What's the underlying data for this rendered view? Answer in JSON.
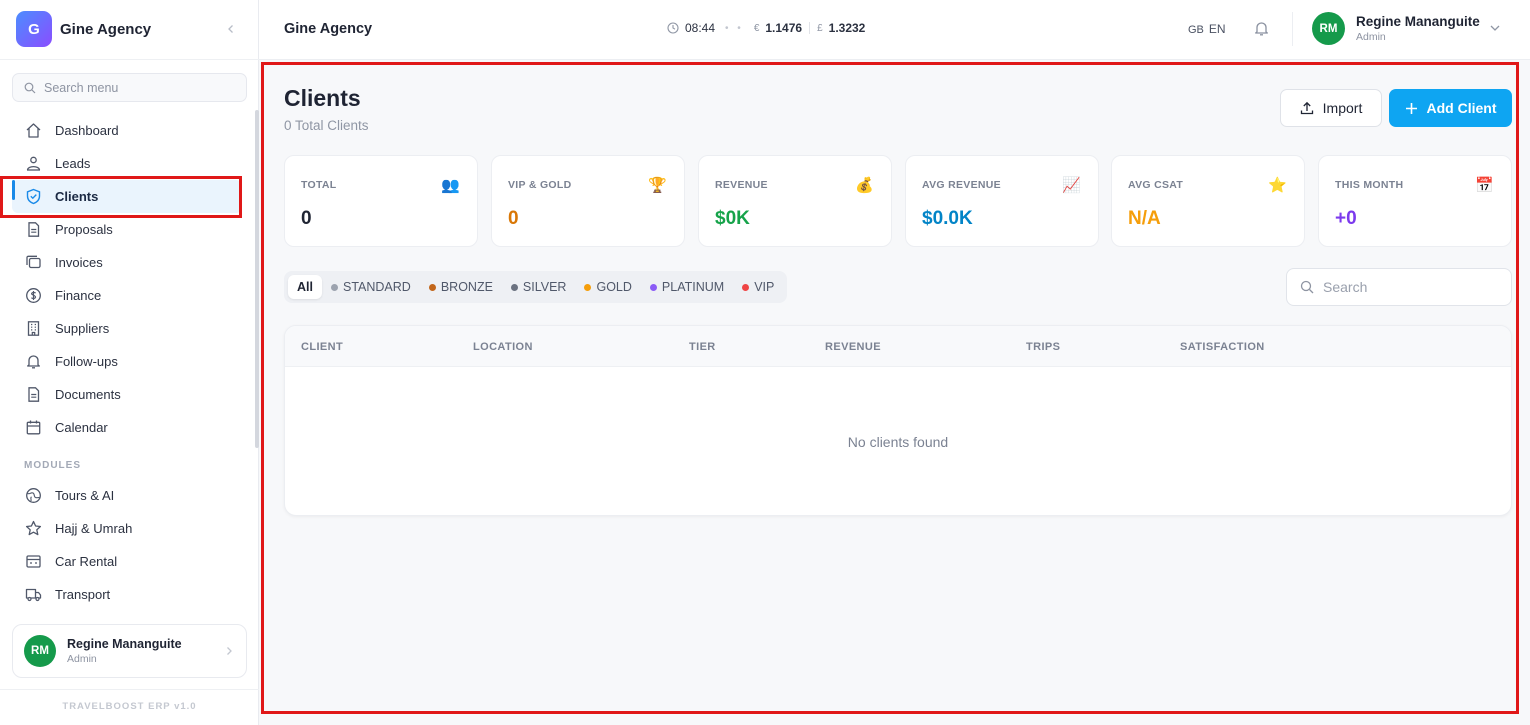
{
  "brand": {
    "logo_letter": "G",
    "name": "Gine Agency"
  },
  "sidebar": {
    "search_placeholder": "Search menu",
    "items": [
      {
        "label": "Dashboard",
        "icon": "home-icon"
      },
      {
        "label": "Leads",
        "icon": "users-icon"
      },
      {
        "label": "Clients",
        "icon": "shield-icon",
        "active": true
      },
      {
        "label": "Proposals",
        "icon": "file-icon"
      },
      {
        "label": "Invoices",
        "icon": "copy-icon"
      },
      {
        "label": "Finance",
        "icon": "dollar-icon"
      },
      {
        "label": "Suppliers",
        "icon": "building-icon"
      },
      {
        "label": "Follow-ups",
        "icon": "bell-icon"
      },
      {
        "label": "Documents",
        "icon": "document-icon"
      },
      {
        "label": "Calendar",
        "icon": "calendar-icon"
      }
    ],
    "modules_label": "MODULES",
    "modules": [
      {
        "label": "Tours & AI",
        "icon": "globe-icon"
      },
      {
        "label": "Hajj & Umrah",
        "icon": "star-icon"
      },
      {
        "label": "Car Rental",
        "icon": "car-icon"
      },
      {
        "label": "Transport",
        "icon": "truck-icon"
      }
    ],
    "user": {
      "initials": "RM",
      "name": "Regine Mananguite",
      "role": "Admin"
    },
    "footer": "TRAVELBOOST ERP v1.0"
  },
  "header": {
    "title": "Gine Agency",
    "time": "08:44",
    "eur_symbol": "€",
    "eur_rate": "1.1476",
    "gbp_symbol": "£",
    "gbp_rate": "1.3232",
    "lang_flag": "GB",
    "lang_code": "EN",
    "user": {
      "initials": "RM",
      "name": "Regine Mananguite",
      "role": "Admin"
    }
  },
  "page": {
    "title": "Clients",
    "subtitle": "0 Total Clients",
    "import_label": "Import",
    "add_label": "Add Client"
  },
  "stats": [
    {
      "label": "TOTAL",
      "value": "0",
      "icon": "👥",
      "color": "#1f2433"
    },
    {
      "label": "VIP & GOLD",
      "value": "0",
      "icon": "🏆",
      "color": "#d97706"
    },
    {
      "label": "REVENUE",
      "value": "$0K",
      "icon": "💰",
      "color": "#16a34a"
    },
    {
      "label": "AVG REVENUE",
      "value": "$0.0K",
      "icon": "📈",
      "color": "#0284c7"
    },
    {
      "label": "AVG CSAT",
      "value": "N/A",
      "icon": "⭐",
      "color": "#f59e0b"
    },
    {
      "label": "THIS MONTH",
      "value": "+0",
      "icon": "📅",
      "color": "#7c3aed"
    }
  ],
  "filters": [
    {
      "label": "All",
      "active": true
    },
    {
      "label": "STANDARD",
      "color": "#9ca3af"
    },
    {
      "label": "BRONZE",
      "color": "#c2661b"
    },
    {
      "label": "SILVER",
      "color": "#6b7280"
    },
    {
      "label": "GOLD",
      "color": "#f59e0b"
    },
    {
      "label": "PLATINUM",
      "color": "#8b5cf6"
    },
    {
      "label": "VIP",
      "color": "#ef4444"
    }
  ],
  "table": {
    "search_placeholder": "Search",
    "columns": [
      "CLIENT",
      "LOCATION",
      "TIER",
      "REVENUE",
      "TRIPS",
      "SATISFACTION"
    ],
    "empty_text": "No clients found"
  }
}
